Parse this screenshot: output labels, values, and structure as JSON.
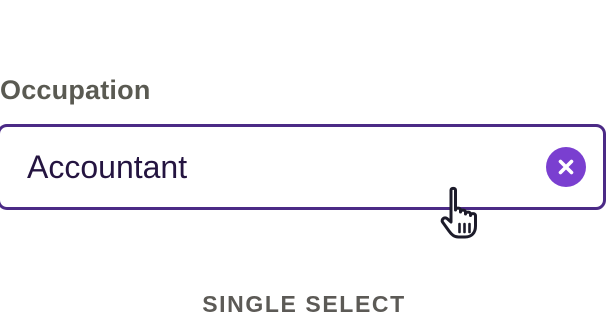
{
  "field": {
    "label": "Occupation",
    "value": "Accountant"
  },
  "icons": {
    "clear": "close-icon",
    "cursor": "hand-pointer-icon"
  },
  "caption": "SINGLE SELECT",
  "colors": {
    "border": "#4b2a86",
    "accent": "#7a3fd0",
    "value_text": "#241440",
    "label_text": "#5a5a52"
  }
}
